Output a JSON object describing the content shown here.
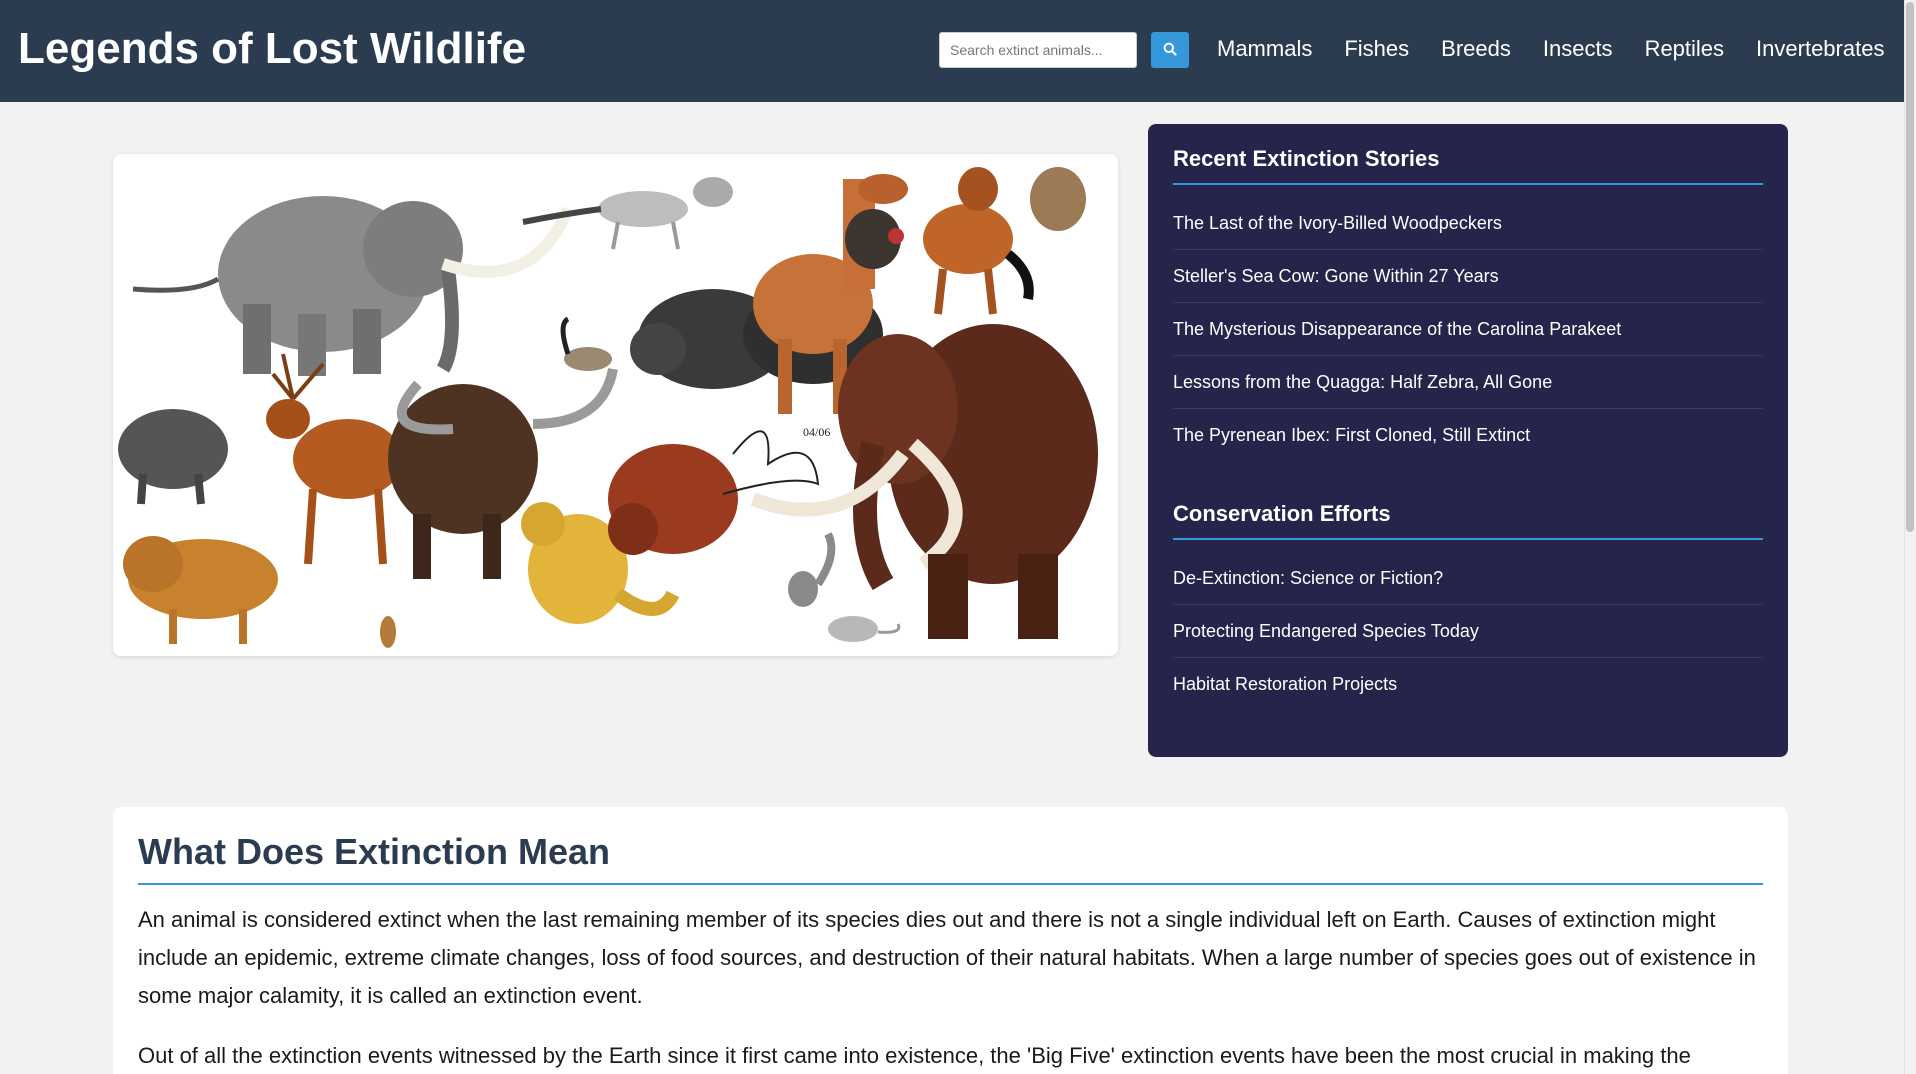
{
  "header": {
    "title": "Legends of Lost Wildlife",
    "search_placeholder": "Search extinct animals...",
    "nav": [
      "Mammals",
      "Fishes",
      "Breeds",
      "Insects",
      "Reptiles",
      "Invertebrates"
    ]
  },
  "sidebar": {
    "sections": [
      {
        "heading": "Recent Extinction Stories",
        "items": [
          "The Last of the Ivory-Billed Woodpeckers",
          "Steller's Sea Cow: Gone Within 27 Years",
          "The Mysterious Disappearance of the Carolina Parakeet",
          "Lessons from the Quagga: Half Zebra, All Gone",
          "The Pyrenean Ibex: First Cloned, Still Extinct"
        ]
      },
      {
        "heading": "Conservation Efforts",
        "items": [
          "De-Extinction: Science or Fiction?",
          "Protecting Endangered Species Today",
          "Habitat Restoration Projects"
        ]
      }
    ]
  },
  "article": {
    "heading": "What Does Extinction Mean",
    "paragraphs": [
      "An animal is considered extinct when the last remaining member of its species dies out and there is not a single individual left on Earth. Causes of extinction might include an epidemic, extreme climate changes, loss of food sources, and destruction of their natural habitats. When a large number of species goes out of existence in some major calamity, it is called an extinction event.",
      "Out of all the extinction events witnessed by the Earth since it first came into existence, the 'Big Five' extinction events have been the most crucial in making the"
    ]
  },
  "colors": {
    "header_bg": "#2b3b50",
    "accent": "#3498db",
    "sidebar_bg": "#25244b",
    "page_bg": "#f2f2f2"
  },
  "icons": {
    "search_button": "search-icon"
  },
  "hero": {
    "signature": "04/06"
  }
}
